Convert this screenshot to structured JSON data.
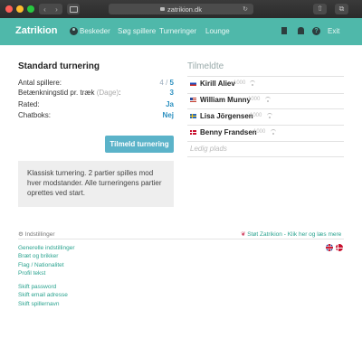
{
  "browser": {
    "url": "zatrikion.dk"
  },
  "nav": {
    "brand": "Zatrikion",
    "links": [
      "Beskeder",
      "Søg spillere",
      "Turneringer",
      "Lounge"
    ],
    "exit": "Exit"
  },
  "tournament": {
    "title": "Standard turnering",
    "rows": [
      {
        "label": "Antal spillere:",
        "value_current": "4",
        "value_sep": " / ",
        "value_total": "5"
      },
      {
        "label": "Betænkningstid pr. træk",
        "note": "(Dage)",
        "suffix": ":",
        "value": "3"
      },
      {
        "label": "Rated:",
        "value": "Ja"
      },
      {
        "label": "Chatboks:",
        "value": "Nej"
      }
    ],
    "join_button": "Tilmeld turnering",
    "description": "Klassisk turnering. 2 partier spilles mod hver modstander. Alle turneringens partier oprettes ved start."
  },
  "registered": {
    "title": "Tilmeldte",
    "players": [
      {
        "name": "Kirill Aliev",
        "rating": "1000",
        "flag": "ru"
      },
      {
        "name": "William Munny",
        "rating": "1000",
        "flag": "us"
      },
      {
        "name": "Lisa Jörgensen",
        "rating": "1000",
        "flag": "se"
      },
      {
        "name": "Benny Frandsen",
        "rating": "1000",
        "flag": "dk"
      }
    ],
    "empty_slot": "Ledig plads"
  },
  "footer": {
    "settings_label": "Indstillinger",
    "support_label": "Støt Zatrikion - Klik her og læs mere",
    "links_group1": [
      "Generelle indstillinger",
      "Bræt og brikker",
      "Flag / Nationalitet",
      "Profil tekst"
    ],
    "links_group2": [
      "Skift password",
      "Skift email adresse",
      "Skift spillernavn"
    ]
  },
  "colors": {
    "nav_bg": "#4fb8aa",
    "accent_value": "#2a8fbf",
    "button_bg": "#5bb3c9",
    "link": "#2aa38f"
  }
}
